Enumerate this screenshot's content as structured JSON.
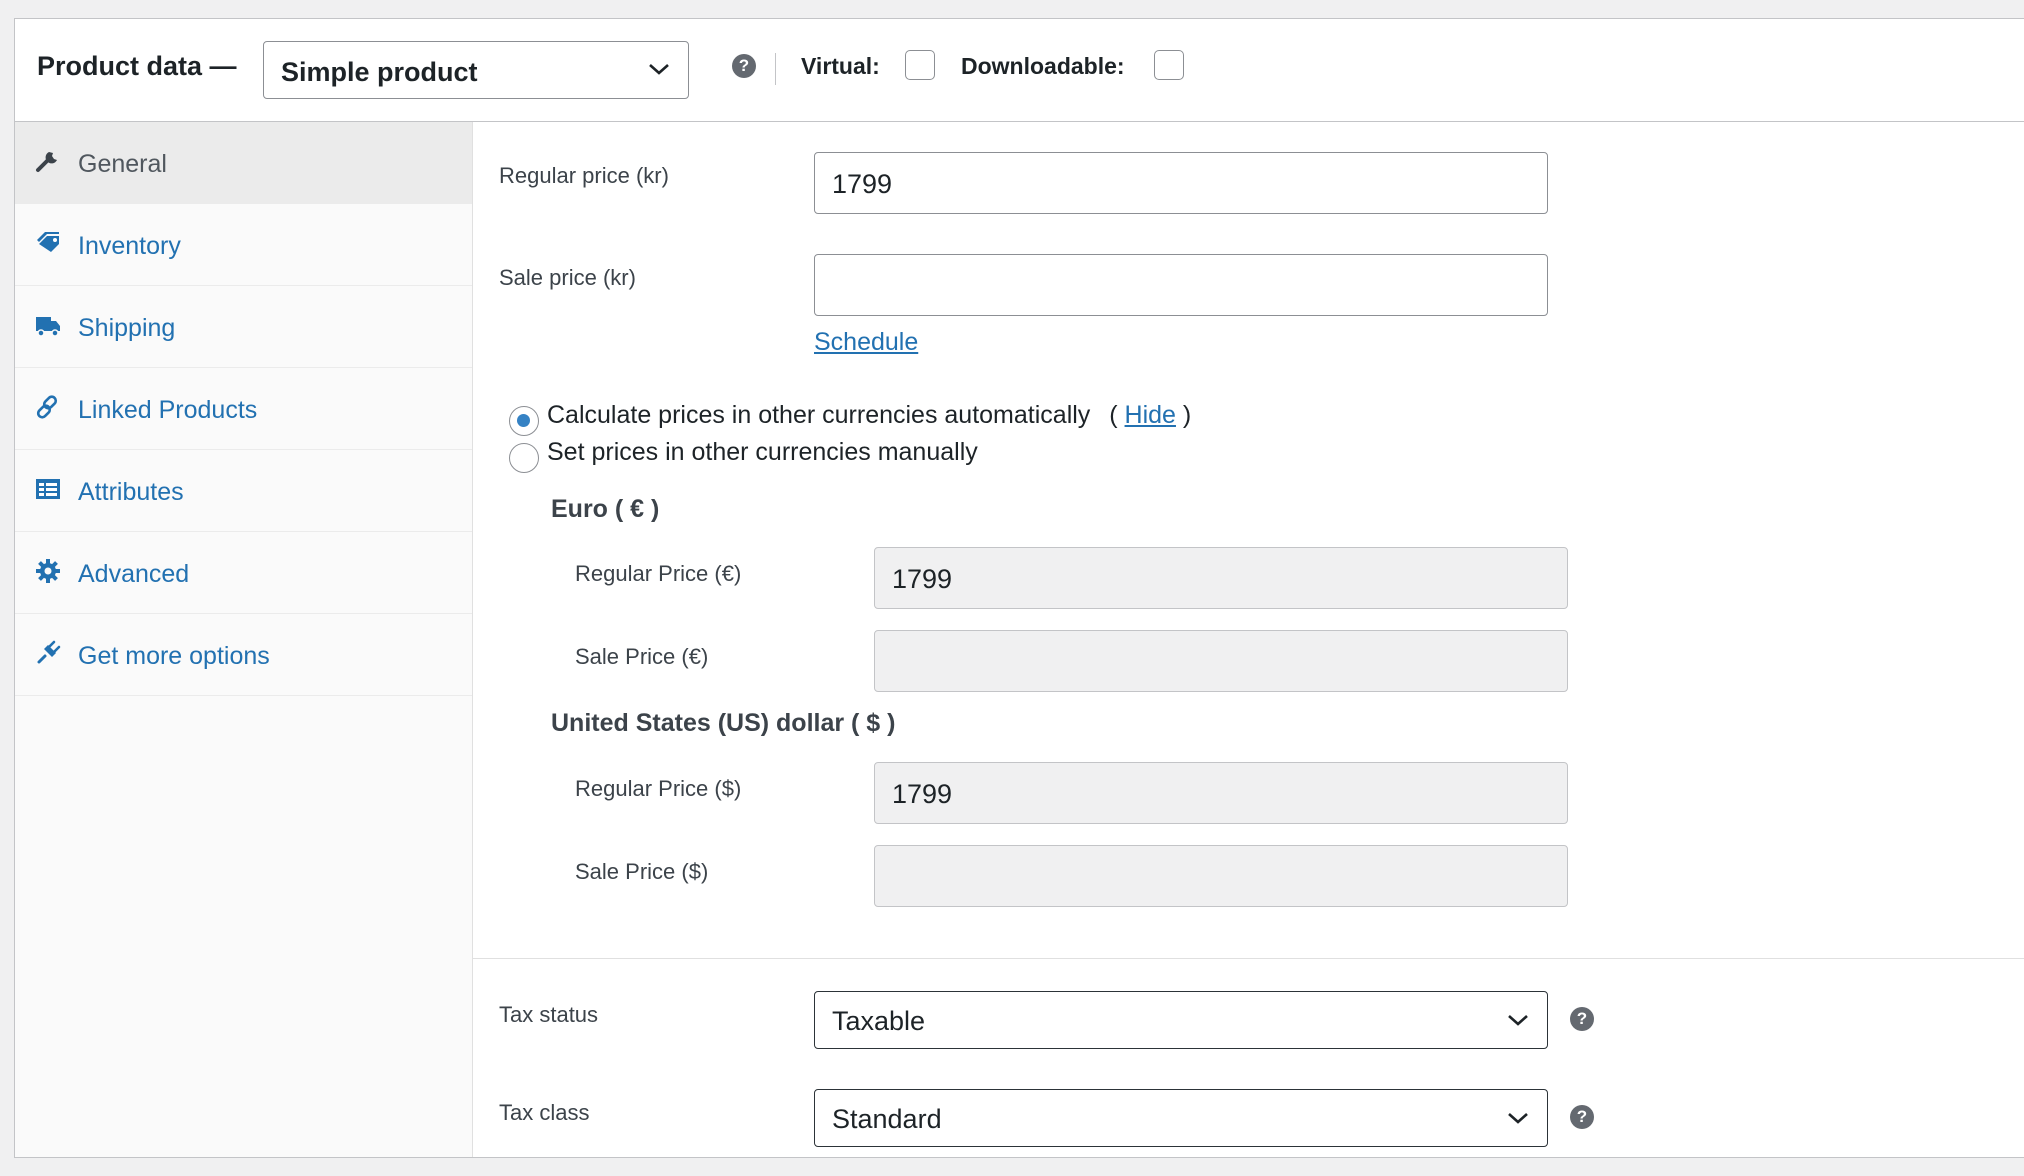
{
  "header": {
    "title": "Product data —",
    "product_type": "Simple product",
    "help_icon": "?",
    "virtual_label": "Virtual:",
    "downloadable_label": "Downloadable:",
    "virtual_checked": false,
    "downloadable_checked": false
  },
  "sidebar": {
    "items": [
      {
        "label": "General",
        "icon": "wrench-icon",
        "active": true
      },
      {
        "label": "Inventory",
        "icon": "tag-icon",
        "active": false
      },
      {
        "label": "Shipping",
        "icon": "truck-icon",
        "active": false
      },
      {
        "label": "Linked Products",
        "icon": "link-icon",
        "active": false
      },
      {
        "label": "Attributes",
        "icon": "list-icon",
        "active": false
      },
      {
        "label": "Advanced",
        "icon": "gear-icon",
        "active": false
      },
      {
        "label": "Get more options",
        "icon": "plugin-icon",
        "active": false
      }
    ]
  },
  "general": {
    "regular_price_label": "Regular price (kr)",
    "regular_price_value": "1799",
    "sale_price_label": "Sale price (kr)",
    "sale_price_value": "",
    "schedule_link": "Schedule",
    "radio_auto_label": "Calculate prices in other currencies automatically",
    "hide_open": "(",
    "hide_link": "Hide",
    "hide_close": ")",
    "radio_manual_label": "Set prices in other currencies manually",
    "radio_selected": "auto",
    "currencies": [
      {
        "heading": "Euro ( € )",
        "regular_label": "Regular Price (€)",
        "regular_value": "1799",
        "sale_label": "Sale Price (€)",
        "sale_value": ""
      },
      {
        "heading": "United States (US) dollar ( $ )",
        "regular_label": "Regular Price ($)",
        "regular_value": "1799",
        "sale_label": "Sale Price ($)",
        "sale_value": ""
      }
    ],
    "tax_status_label": "Tax status",
    "tax_status_value": "Taxable",
    "tax_class_label": "Tax class",
    "tax_class_value": "Standard"
  },
  "colors": {
    "link": "#2271b1",
    "radio_accent": "#3582c4",
    "readonly_bg": "#f0f0f1"
  }
}
